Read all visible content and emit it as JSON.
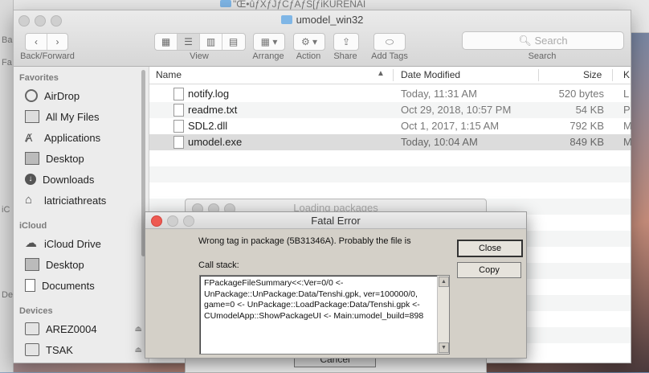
{
  "background_window": {
    "title": "\"Œ•ûƒXƒJƒCƒAƒS[ƒiKURENAI",
    "strip_labels": [
      "Ba",
      "Fa",
      "iC",
      "De"
    ]
  },
  "finder": {
    "window_title": "umodel_win32",
    "toolbar": {
      "back_forward_label": "Back/Forward",
      "view_label": "View",
      "arrange_label": "Arrange",
      "action_label": "Action",
      "share_label": "Share",
      "add_tags_label": "Add Tags",
      "search_label": "Search",
      "search_placeholder": "Search"
    },
    "sidebar": {
      "favorites_header": "Favorites",
      "favorites": [
        {
          "label": "AirDrop",
          "icon": "airdrop-icon"
        },
        {
          "label": "All My Files",
          "icon": "all-files-icon"
        },
        {
          "label": "Applications",
          "icon": "applications-icon"
        },
        {
          "label": "Desktop",
          "icon": "desktop-icon"
        },
        {
          "label": "Downloads",
          "icon": "downloads-icon"
        },
        {
          "label": "latriciathreats",
          "icon": "home-icon"
        }
      ],
      "icloud_header": "iCloud",
      "icloud": [
        {
          "label": "iCloud Drive",
          "icon": "cloud-icon"
        },
        {
          "label": "Desktop",
          "icon": "desktop-icon"
        },
        {
          "label": "Documents",
          "icon": "documents-icon"
        }
      ],
      "devices_header": "Devices",
      "devices": [
        {
          "label": "AREZ0004",
          "icon": "drive-icon"
        },
        {
          "label": "TSAK",
          "icon": "drive-icon"
        }
      ]
    },
    "list": {
      "columns": {
        "name": "Name",
        "date": "Date Modified",
        "size": "Size",
        "kind": "K"
      },
      "rows": [
        {
          "name": "notify.log",
          "date": "Today, 11:31 AM",
          "size": "520 bytes",
          "kind": "L"
        },
        {
          "name": "readme.txt",
          "date": "Oct 29, 2018, 10:57 PM",
          "size": "54 KB",
          "kind": "P"
        },
        {
          "name": "SDL2.dll",
          "date": "Oct 1, 2017, 1:15 AM",
          "size": "792 KB",
          "kind": "M"
        },
        {
          "name": "umodel.exe",
          "date": "Today, 10:04 AM",
          "size": "849 KB",
          "kind": "M"
        }
      ]
    }
  },
  "loading_dialog": {
    "title": "Loading packages",
    "cancel_label": "Cancel"
  },
  "fatal_dialog": {
    "title": "Fatal Error",
    "message": "Wrong tag in package (5B31346A). Probably the file is",
    "call_stack_label": "Call stack:",
    "call_stack": "FPackageFileSummary<<:Ver=0/0 <-\nUnPackage::UnPackage:Data/Tenshi.gpk, ver=100000/0,\ngame=0 <- UnPackage::LoadPackage:Data/Tenshi.gpk <-\nCUmodelApp::ShowPackageUI <- Main:umodel_build=898",
    "close_label": "Close",
    "copy_label": "Copy",
    "close_button_color": "#ee5a52"
  }
}
